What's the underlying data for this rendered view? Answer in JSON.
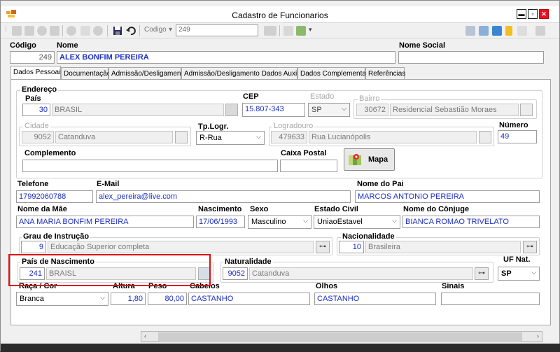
{
  "window": {
    "title": "Cadastro de Funcionarios"
  },
  "toolbar": {
    "codigo_label": "Codigo",
    "codigo_value": "249"
  },
  "header": {
    "codigo_label": "Código",
    "codigo_value": "249",
    "nome_label": "Nome",
    "nome_value": "ALEX BONFIM PEREIRA",
    "nome_social_label": "Nome Social",
    "nome_social_value": ""
  },
  "tabs": [
    "Dados Pessoais",
    "Documentação",
    "Admissão/Desligamento",
    "Admissão/Desligamento Dados Auxiliares",
    "Dados Complementares",
    "Referências"
  ],
  "endereco": {
    "title": "Endereço",
    "pais_label": "País",
    "pais_code": "30",
    "pais_name": "BRASIL",
    "cep_label": "CEP",
    "cep_value": "15.807-343",
    "estado_label": "Estado",
    "estado_value": "SP",
    "bairro_label": "Bairro",
    "bairro_code": "30672",
    "bairro_name": "Residencial Sebastião Moraes",
    "cidade_label": "Cidade",
    "cidade_code": "9052",
    "cidade_name": "Catanduva",
    "tplogr_label": "Tp.Logr.",
    "tplogr_value": "R-Rua",
    "logradouro_label": "Logradouro",
    "logradouro_code": "479633",
    "logradouro_name": "Rua Lucianópolis",
    "numero_label": "Número",
    "numero_value": "49",
    "complemento_label": "Complemento",
    "complemento_value": "",
    "caixa_postal_label": "Caixa Postal",
    "caixa_postal_value": "",
    "mapa_label": "Mapa"
  },
  "contato": {
    "telefone_label": "Telefone",
    "telefone_value": "17992060788",
    "email_label": "E-Mail",
    "email_value": "alex_pereira@live.com",
    "pai_label": "Nome do Pai",
    "pai_value": "MARCOS ANTONIO PEREIRA",
    "mae_label": "Nome da Mãe",
    "mae_value": "ANA MARIA BONFIM PEREIRA",
    "nascimento_label": "Nascimento",
    "nascimento_value": "17/06/1993",
    "sexo_label": "Sexo",
    "sexo_value": "Masculino",
    "estado_civil_label": "Estado Civil",
    "estado_civil_value": "UniaoEstavel",
    "conjuge_label": "Nome do Cônjuge",
    "conjuge_value": "BIANCA ROMAO TRIVELATO"
  },
  "instrucao": {
    "grau_label": "Grau de Instrução",
    "grau_code": "9",
    "grau_name": "Educação Superior completa",
    "nacionalidade_label": "Nacionalidade",
    "nacionalidade_code": "10",
    "nacionalidade_name": "Brasileira"
  },
  "nascimento": {
    "pais_label": "País de Nascimento",
    "pais_code": "241",
    "pais_name": "BRAISL",
    "naturalidade_label": "Naturalidade",
    "naturalidade_code": "9052",
    "naturalidade_name": "Catanduva",
    "uf_label": "UF Nat.",
    "uf_value": "SP"
  },
  "fisico": {
    "raca_label": "Raça / Cor",
    "raca_value": "Branca",
    "altura_label": "Altura",
    "altura_value": "1,80",
    "peso_label": "Peso",
    "peso_value": "80,00",
    "cabelos_label": "Cabelos",
    "cabelos_value": "CASTANHO",
    "olhos_label": "Olhos",
    "olhos_value": "CASTANHO",
    "sinais_label": "Sinais",
    "sinais_value": ""
  },
  "colors": {
    "accent_text": "#1c2fc4",
    "highlight_border": "#e01010",
    "close_button": "#e81123"
  },
  "icons": [
    "app-icon",
    "save-icon",
    "undo-icon",
    "search-icon",
    "map-icon",
    "dropdown-arrow-icon"
  ]
}
